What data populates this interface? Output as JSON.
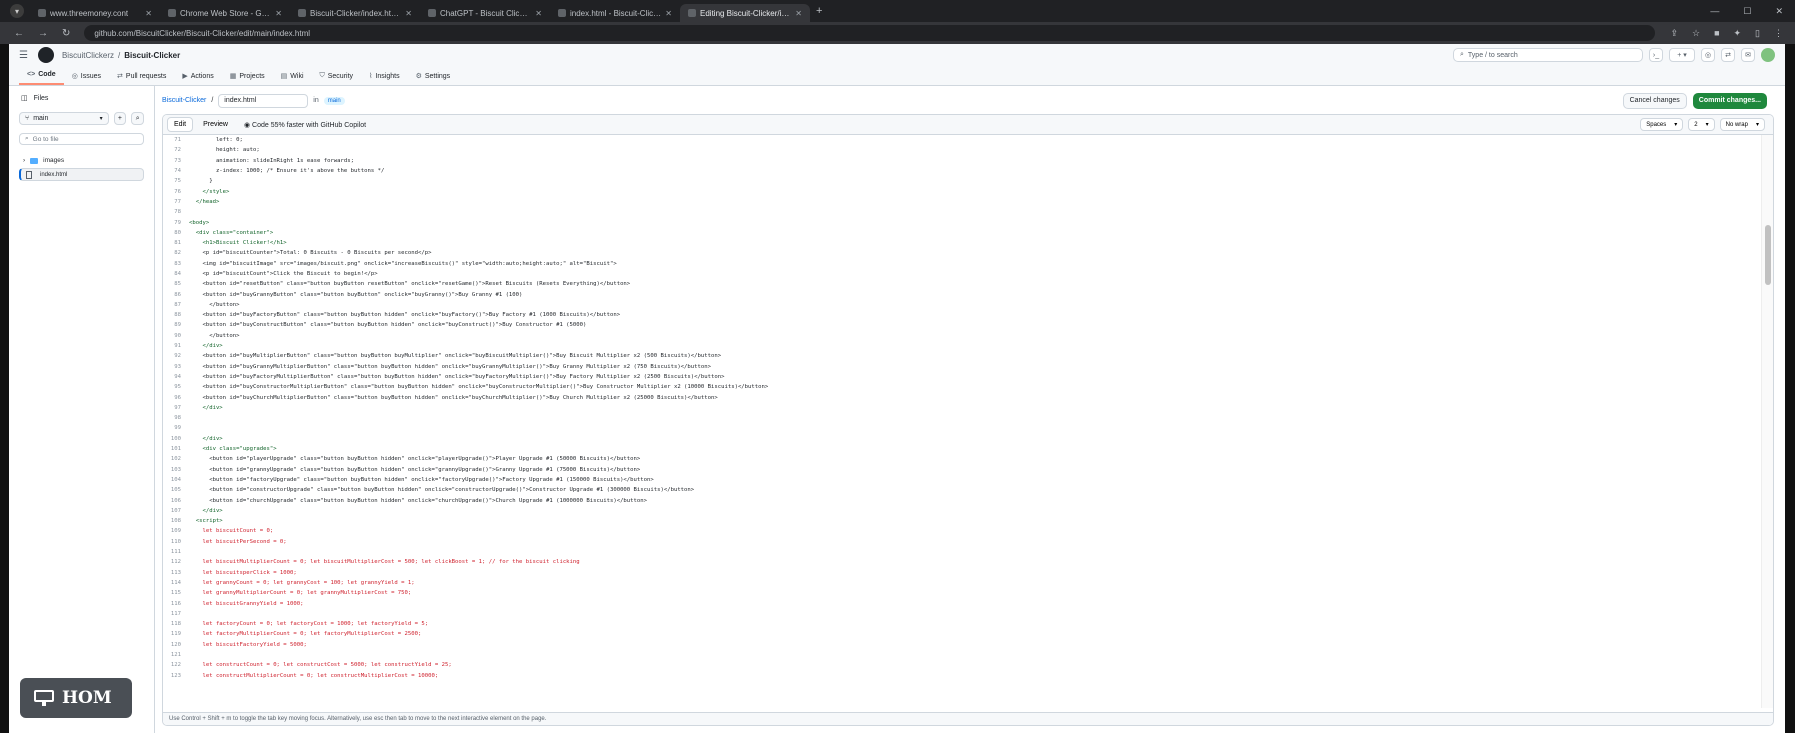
{
  "browser": {
    "tabs": [
      {
        "label": "www.threemoney.cont",
        "active": false
      },
      {
        "label": "Chrome Web Store - Google",
        "active": false
      },
      {
        "label": "Biscuit-Clicker/index.html at main",
        "active": false
      },
      {
        "label": "ChatGPT - Biscuit Clicker Game",
        "active": false
      },
      {
        "label": "index.html - Biscuit-Clicker",
        "active": false
      },
      {
        "label": "Editing Biscuit-Clicker/index.ht",
        "active": true
      }
    ],
    "new_tab": "+",
    "url": "github.com/BiscuitClicker/Biscuit-Clicker/edit/main/index.html"
  },
  "github": {
    "owner": "BiscuitClickerz",
    "repo": "Biscuit-Clicker",
    "search_placeholder": "Type / to search",
    "repo_nav": [
      {
        "label": "Code",
        "icon": "code-icon",
        "active": true
      },
      {
        "label": "Issues",
        "icon": "issue-icon",
        "active": false
      },
      {
        "label": "Pull requests",
        "icon": "pull-request-icon",
        "active": false
      },
      {
        "label": "Actions",
        "icon": "actions-icon",
        "active": false
      },
      {
        "label": "Projects",
        "icon": "projects-icon",
        "active": false
      },
      {
        "label": "Wiki",
        "icon": "wiki-icon",
        "active": false
      },
      {
        "label": "Security",
        "icon": "shield-icon",
        "active": false
      },
      {
        "label": "Insights",
        "icon": "graph-icon",
        "active": false
      },
      {
        "label": "Settings",
        "icon": "gear-icon",
        "active": false
      }
    ]
  },
  "sidebar": {
    "title": "Files",
    "branch": "main",
    "go_to_file": "Go to file",
    "tree": [
      {
        "label": "images",
        "type": "folder"
      },
      {
        "label": "index.html",
        "type": "file",
        "selected": true
      }
    ]
  },
  "editor": {
    "repo_link": "Biscuit-Clicker",
    "separator": "/",
    "filename": "index.html",
    "in_label": "in",
    "branch_badge": "main",
    "cancel_label": "Cancel changes",
    "commit_label": "Commit changes...",
    "tab_edit": "Edit",
    "tab_preview": "Preview",
    "copilot_label": "Code 55% faster with GitHub Copilot",
    "indent_mode": "Spaces",
    "indent_size": "2",
    "wrap_mode": "No wrap",
    "status_text": "Use Control + Shift + m to toggle the tab key moving focus. Alternatively, use esc then tab to move to the next interactive element on the page."
  },
  "code_lines": [
    {
      "n": "71",
      "t": "        left: 0;",
      "c": "tx"
    },
    {
      "n": "72",
      "t": "        height: auto;",
      "c": "tx"
    },
    {
      "n": "73",
      "t": "        animation: slideInRight 1s ease forwards;",
      "c": "tx"
    },
    {
      "n": "74",
      "t": "        z-index: 1000; /* Ensure it's above the buttons */",
      "c": "tx"
    },
    {
      "n": "75",
      "t": "      }",
      "c": "tx"
    },
    {
      "n": "76",
      "t": "    </style>",
      "c": "tag"
    },
    {
      "n": "77",
      "t": "  </head>",
      "c": "tag"
    },
    {
      "n": "78",
      "t": "",
      "c": "tx"
    },
    {
      "n": "79",
      "t": "<body>",
      "c": "tag"
    },
    {
      "n": "80",
      "t": "  <div class=\"container\">",
      "c": "tag"
    },
    {
      "n": "81",
      "t": "    <h1>Biscuit Clicker!</h1>",
      "c": "tag"
    },
    {
      "n": "82",
      "t": "    <p id=\"biscuitCounter\">Total: 0 Biscuits - 0 Biscuits per second</p>",
      "c": "tx"
    },
    {
      "n": "83",
      "t": "    <img id=\"biscuitImage\" src=\"images/biscuit.png\" onclick=\"increaseBiscuits()\" style=\"width:auto;height:auto;\" alt=\"Biscuit\">",
      "c": "tx"
    },
    {
      "n": "84",
      "t": "    <p id=\"biscuitCount\">Click the Biscuit to begin!</p>",
      "c": "tx"
    },
    {
      "n": "85",
      "t": "    <button id=\"resetButton\" class=\"button buyButton resetButton\" onclick=\"resetGame()\">Reset Biscuits (Resets Everything)</button>",
      "c": "tx"
    },
    {
      "n": "86",
      "t": "    <button id=\"buyGrannyButton\" class=\"button buyButton\" onclick=\"buyGranny()\">Buy Granny #1 (100)",
      "c": "tx"
    },
    {
      "n": "87",
      "t": "      </button>",
      "c": "tx"
    },
    {
      "n": "88",
      "t": "    <button id=\"buyFactoryButton\" class=\"button buyButton hidden\" onclick=\"buyFactory()\">Buy Factory #1 (1000 Biscuits)</button>",
      "c": "tx"
    },
    {
      "n": "89",
      "t": "    <button id=\"buyConstructButton\" class=\"button buyButton hidden\" onclick=\"buyConstruct()\">Buy Constructor #1 (5000)",
      "c": "tx"
    },
    {
      "n": "90",
      "t": "      </button>",
      "c": "tx"
    },
    {
      "n": "91",
      "t": "    </div>",
      "c": "tag"
    },
    {
      "n": "92",
      "t": "    <button id=\"buyMultiplierButton\" class=\"button buyButton buyMultiplier\" onclick=\"buyBiscuitMultiplier()\">Buy Biscuit Multiplier x2 (500 Biscuits)</button>",
      "c": "tx"
    },
    {
      "n": "93",
      "t": "    <button id=\"buyGrannyMultiplierButton\" class=\"button buyButton hidden\" onclick=\"buyGrannyMultiplier()\">Buy Granny Multiplier x2 (750 Biscuits)</button>",
      "c": "tx"
    },
    {
      "n": "94",
      "t": "    <button id=\"buyFactoryMultiplierButton\" class=\"button buyButton hidden\" onclick=\"buyFactoryMultiplier()\">Buy Factory Multiplier x2 (2500 Biscuits)</button>",
      "c": "tx"
    },
    {
      "n": "95",
      "t": "    <button id=\"buyConstructorMultiplierButton\" class=\"button buyButton hidden\" onclick=\"buyConstructorMultiplier()\">Buy Constructor Multiplier x2 (10000 Biscuits)</button>",
      "c": "tx"
    },
    {
      "n": "96",
      "t": "    <button id=\"buyChurchMultiplierButton\" class=\"button buyButton hidden\" onclick=\"buyChurchMultiplier()\">Buy Church Multiplier x2 (25000 Biscuits)</button>",
      "c": "tx"
    },
    {
      "n": "97",
      "t": "    </div>",
      "c": "tag"
    },
    {
      "n": "98",
      "t": "",
      "c": "tx"
    },
    {
      "n": "99",
      "t": "",
      "c": "tx"
    },
    {
      "n": "100",
      "t": "    </div>",
      "c": "tag"
    },
    {
      "n": "101",
      "t": "    <div class=\"upgrades\">",
      "c": "tag"
    },
    {
      "n": "102",
      "t": "      <button id=\"playerUpgrade\" class=\"button buyButton hidden\" onclick=\"playerUpgrade()\">Player Upgrade #1 (50000 Biscuits)</button>",
      "c": "tx"
    },
    {
      "n": "103",
      "t": "      <button id=\"grannyUpgrade\" class=\"button buyButton hidden\" onclick=\"grannyUpgrade()\">Granny Upgrade #1 (75000 Biscuits)</button>",
      "c": "tx"
    },
    {
      "n": "104",
      "t": "      <button id=\"factoryUpgrade\" class=\"button buyButton hidden\" onclick=\"factoryUpgrade()\">Factory Upgrade #1 (150000 Biscuits)</button>",
      "c": "tx"
    },
    {
      "n": "105",
      "t": "      <button id=\"constructorUpgrade\" class=\"button buyButton hidden\" onclick=\"constructorUpgrade()\">Constructor Upgrade #1 (300000 Biscuits)</button>",
      "c": "tx"
    },
    {
      "n": "106",
      "t": "      <button id=\"churchUpgrade\" class=\"button buyButton hidden\" onclick=\"churchUpgrade()\">Church Upgrade #1 (1000000 Biscuits)</button>",
      "c": "tx"
    },
    {
      "n": "107",
      "t": "    </div>",
      "c": "tag"
    },
    {
      "n": "108",
      "t": "  <script>",
      "c": "tag"
    },
    {
      "n": "109",
      "t": "    let biscuitCount = 0;",
      "c": "kw"
    },
    {
      "n": "110",
      "t": "    let biscuitPerSecond = 0;",
      "c": "kw"
    },
    {
      "n": "111",
      "t": "",
      "c": "tx"
    },
    {
      "n": "112",
      "t": "    let biscuitMultiplierCount = 0; let biscuitMultiplierCost = 500; let clickBoost = 1; // for the biscuit clicking",
      "c": "kw"
    },
    {
      "n": "113",
      "t": "    let biscuitsperClick = 1000;",
      "c": "kw"
    },
    {
      "n": "114",
      "t": "    let grannyCount = 0; let grannyCost = 100; let grannyYield = 1;",
      "c": "kw"
    },
    {
      "n": "115",
      "t": "    let grannyMultiplierCount = 0; let grannyMultiplierCost = 750;",
      "c": "kw"
    },
    {
      "n": "116",
      "t": "    let biscuitGrannyYield = 1000;",
      "c": "kw"
    },
    {
      "n": "117",
      "t": "",
      "c": "tx"
    },
    {
      "n": "118",
      "t": "    let factoryCount = 0; let factoryCost = 1000; let factoryYield = 5;",
      "c": "kw"
    },
    {
      "n": "119",
      "t": "    let factoryMultiplierCount = 0; let factoryMultiplierCost = 2500;",
      "c": "kw"
    },
    {
      "n": "120",
      "t": "    let biscuitFactoryYield = 5000;",
      "c": "kw"
    },
    {
      "n": "121",
      "t": "",
      "c": "tx"
    },
    {
      "n": "122",
      "t": "    let constructCount = 0; let constructCost = 5000; let constructYield = 25;",
      "c": "kw"
    },
    {
      "n": "123",
      "t": "    let constructMultiplierCount = 0; let constructMultiplierCost = 10000;",
      "c": "kw"
    }
  ],
  "overlay": {
    "label": "HOM",
    "icon": "monitor-icon"
  }
}
